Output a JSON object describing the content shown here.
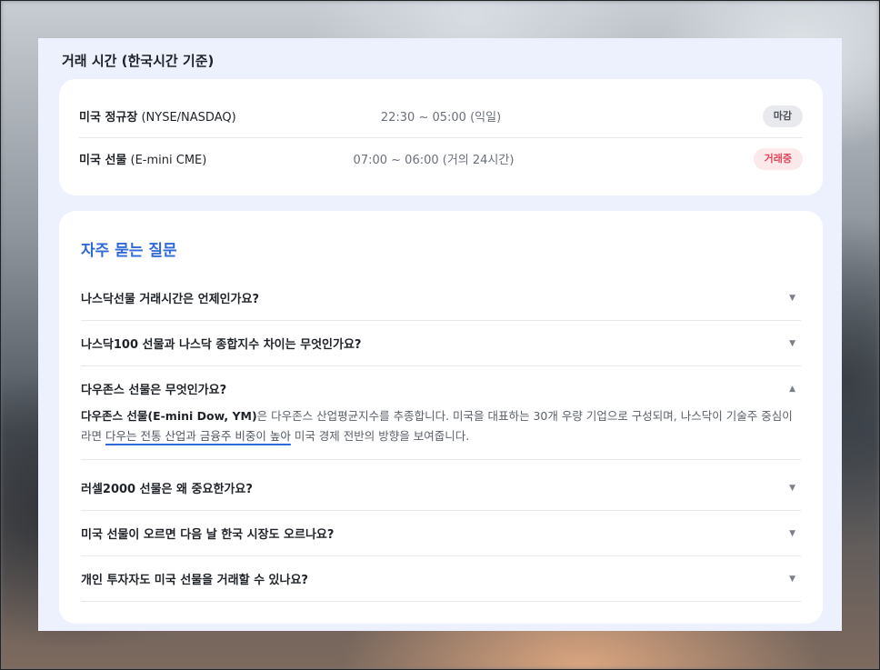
{
  "hours": {
    "title": "거래 시간 (한국시간 기준)",
    "rows": [
      {
        "name": "미국 정규장",
        "name_sub": " (NYSE/NASDAQ)",
        "time": "22:30 ~ 05:00 (익일)",
        "badge": "마감",
        "status": "closed"
      },
      {
        "name": "미국 선물",
        "name_sub": " (E-mini CME)",
        "time": "07:00 ~ 06:00 (거의 24시간)",
        "badge": "거래중",
        "status": "open"
      }
    ]
  },
  "faq": {
    "title": "자주 묻는 질문",
    "items": [
      {
        "q": "나스닥선물 거래시간은 언제인가요?",
        "expanded": false,
        "arrow": "▼"
      },
      {
        "q": "나스닥100 선물과 나스닥 종합지수 차이는 무엇인가요?",
        "expanded": false,
        "arrow": "▼"
      },
      {
        "q": "다우존스 선물은 무엇인가요?",
        "expanded": true,
        "arrow": "▲",
        "a_bold": "다우존스 선물(E-mini Dow, YM)",
        "a_part1": "은 다우존스 산업평균지수를 추종합니다. 미국을 대표하는 30개 우량 기업으로 구성되며, 나스닥이 기술주 중심이라면 ",
        "a_highlight": "다우는 전통 산업과 금융주 비중이 높아",
        "a_part2": " 미국 경제 전반의 방향을 보여줍니다."
      },
      {
        "q": "러셀2000 선물은 왜 중요한가요?",
        "expanded": false,
        "arrow": "▼"
      },
      {
        "q": "미국 선물이 오르면 다음 날 한국 시장도 오르나요?",
        "expanded": false,
        "arrow": "▼"
      },
      {
        "q": "개인 투자자도 미국 선물을 거래할 수 있나요?",
        "expanded": false,
        "arrow": "▼"
      }
    ]
  },
  "colors": {
    "accent": "#2f6bd8",
    "open_badge": "#e0485a",
    "panel_bg": "#edf1fd"
  }
}
